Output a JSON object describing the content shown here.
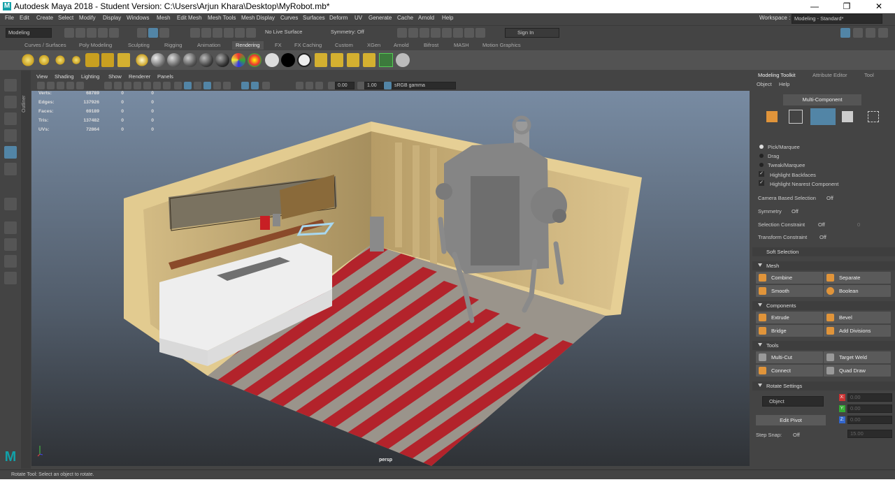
{
  "window": {
    "title": "Autodesk Maya 2018 - Student Version: C:\\Users\\Arjun Khara\\Desktop\\MyRobot.mb*",
    "logo": "M",
    "minimize": "—",
    "maximize": "❐",
    "close": "✕"
  },
  "menu": [
    "File",
    "Edit",
    "Create",
    "Select",
    "Modify",
    "Display",
    "Windows",
    "Mesh",
    "Edit Mesh",
    "Mesh Tools",
    "Mesh Display",
    "Curves",
    "Surfaces",
    "Deform",
    "UV",
    "Generate",
    "Cache",
    "Arnold",
    "Help"
  ],
  "workspace": {
    "label": "Workspace :",
    "value": "Modeling - Standard*"
  },
  "status": {
    "mode": "Modeling",
    "live_surface": "No Live Surface",
    "symmetry": "Symmetry: Off",
    "sign_in": "Sign In"
  },
  "shelf_tabs": [
    "Curves / Surfaces",
    "Poly Modeling",
    "Sculpting",
    "Rigging",
    "Animation",
    "Rendering",
    "FX",
    "FX Caching",
    "Custom",
    "XGen",
    "Arnold",
    "Bifrost",
    "MASH",
    "Motion Graphics"
  ],
  "shelf_active": "Rendering",
  "viewport": {
    "menus": [
      "View",
      "Shading",
      "Lighting",
      "Show",
      "Renderer",
      "Panels"
    ],
    "exposure": "0.00",
    "gamma": "1.00",
    "colorspace": "sRGB gamma",
    "camera": "persp",
    "outliner_label": "Outliner"
  },
  "hud": [
    {
      "label": "Verts:",
      "a": "68789",
      "b": "0",
      "c": "0"
    },
    {
      "label": "Edges:",
      "a": "137926",
      "b": "0",
      "c": "0"
    },
    {
      "label": "Faces:",
      "a": "69189",
      "b": "0",
      "c": "0"
    },
    {
      "label": "Tris:",
      "a": "137482",
      "b": "0",
      "c": "0"
    },
    {
      "label": "UVs:",
      "a": "72864",
      "b": "0",
      "c": "0"
    }
  ],
  "panel": {
    "tabs": [
      "Modeling Toolkit",
      "Attribute Editor",
      "Tool"
    ],
    "submenu": [
      "Object",
      "Help"
    ],
    "multi_component": "Multi-Component",
    "options": [
      "Pick/Marquee",
      "Drag",
      "Tweak/Marquee"
    ],
    "checks": [
      "Highlight Backfaces",
      "Highlight Nearest Component"
    ],
    "camera_sel": "Camera Based Selection",
    "camera_sel_val": "Off",
    "symmetry": "Symmetry",
    "symmetry_val": "Off",
    "sel_constraint": "Selection Constraint",
    "sel_constraint_val": "Off",
    "sel_constraint_num": "0",
    "transform_constraint": "Transform Constraint",
    "transform_constraint_val": "Off",
    "soft_selection": "Soft Selection",
    "mesh": "Mesh",
    "combine": "Combine",
    "separate": "Separate",
    "smooth": "Smooth",
    "boolean": "Boolean",
    "components": "Components",
    "extrude": "Extrude",
    "bevel": "Bevel",
    "bridge": "Bridge",
    "add_divisions": "Add Divisions",
    "tools": "Tools",
    "multi_cut": "Multi-Cut",
    "target_weld": "Target Weld",
    "connect": "Connect",
    "quad_draw": "Quad Draw",
    "rotate_settings": "Rotate Settings",
    "object": "Object",
    "edit_pivot": "Edit Pivot",
    "x": "X:",
    "y": "Y:",
    "z": "Z:",
    "xv": "0.00",
    "yv": "0.00",
    "zv": "0.00",
    "step_snap": "Step Snap:",
    "step_snap_val": "Off",
    "step_num": "15.00"
  },
  "helpline": "Rotate Tool: Select an object to rotate.",
  "colors": {
    "accent": "#5285a6",
    "floor_red": "#b3232b",
    "floor_grey": "#9a948b",
    "wall": "#d9c188"
  }
}
